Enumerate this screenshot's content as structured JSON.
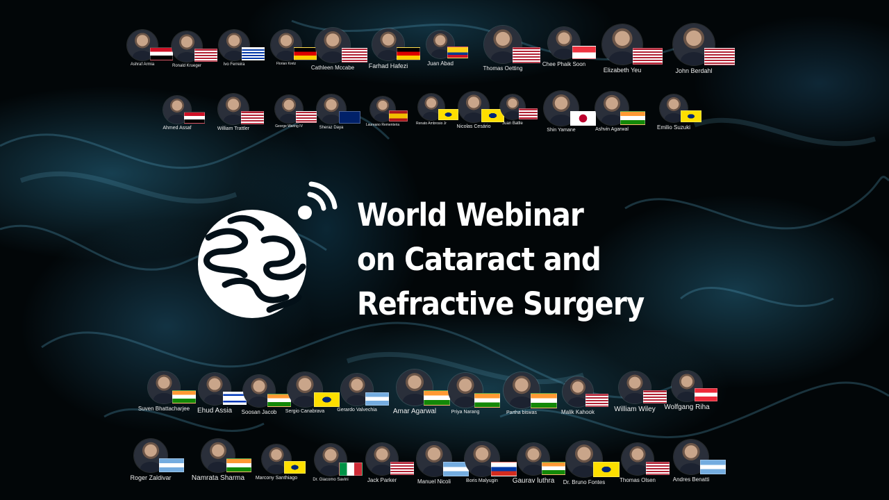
{
  "title": {
    "line1": "World Webinar",
    "line2": "on Cataract and",
    "line3": "Refractive Surgery"
  },
  "speakers": [
    {
      "name": "Ashraf Armia",
      "flag": "egypt"
    },
    {
      "name": "Ronald Krueger",
      "flag": "usa"
    },
    {
      "name": "Ivo Ferreira",
      "flag": "uruguay"
    },
    {
      "name": "Florian Kretz",
      "flag": "germany"
    },
    {
      "name": "Cathleen Mccabe",
      "flag": "usa"
    },
    {
      "name": "Farhad Hafezi",
      "flag": "germany"
    },
    {
      "name": "Juan Abad",
      "flag": "colombia"
    },
    {
      "name": "Thomas Oetting",
      "flag": "usa"
    },
    {
      "name": "Chee Phaik Soon",
      "flag": "singapore"
    },
    {
      "name": "Elizabeth Yeu",
      "flag": "usa"
    },
    {
      "name": "John Berdahl",
      "flag": "usa"
    },
    {
      "name": "Ahmed Assaf",
      "flag": "egypt"
    },
    {
      "name": "William Trattler",
      "flag": "usa"
    },
    {
      "name": "George Waring IV",
      "flag": "usa"
    },
    {
      "name": "Sheraz Daya",
      "flag": "uk"
    },
    {
      "name": "Laureano Rementeria",
      "flag": "spain"
    },
    {
      "name": "Renato Ambrosio Jr",
      "flag": "brazil"
    },
    {
      "name": "Nicolas Cesário",
      "flag": "brazil"
    },
    {
      "name": "Juan Batlle",
      "flag": "usa"
    },
    {
      "name": "Shin Yamane",
      "flag": "japan"
    },
    {
      "name": "Ashvin Agarwal",
      "flag": "india"
    },
    {
      "name": "Emilio Suzuki",
      "flag": "brazil"
    },
    {
      "name": "Suven Bhattacharjee",
      "flag": "india"
    },
    {
      "name": "Ehud Assia",
      "flag": "israel"
    },
    {
      "name": "Soosan Jacob",
      "flag": "india"
    },
    {
      "name": "Sergio Canabrava",
      "flag": "brazil"
    },
    {
      "name": "Gerardo Valvechia",
      "flag": "argentina"
    },
    {
      "name": "Amar Agarwal",
      "flag": "india"
    },
    {
      "name": "Priya Narang",
      "flag": "india"
    },
    {
      "name": "Partha biswas",
      "flag": "india"
    },
    {
      "name": "Malik Kahook",
      "flag": "usa"
    },
    {
      "name": "William Wiley",
      "flag": "usa"
    },
    {
      "name": "Wolfgang Riha",
      "flag": "austria"
    },
    {
      "name": "Roger Zaldivar",
      "flag": "argentina"
    },
    {
      "name": "Namrata Sharma",
      "flag": "india"
    },
    {
      "name": "Marcony Santhiago",
      "flag": "brazil"
    },
    {
      "name": "Dr. Giacomo Savini",
      "flag": "italy"
    },
    {
      "name": "Jack Parker",
      "flag": "usa"
    },
    {
      "name": "Manuel Nicoli",
      "flag": "argentina"
    },
    {
      "name": "Boris Malyugin",
      "flag": "russia"
    },
    {
      "name": "Gaurav luthra",
      "flag": "india"
    },
    {
      "name": "Dr. Bruno Fontes",
      "flag": "brazil"
    },
    {
      "name": "Thomas Olsen",
      "flag": "usa"
    },
    {
      "name": "Andres Benatti",
      "flag": "argentina"
    }
  ]
}
